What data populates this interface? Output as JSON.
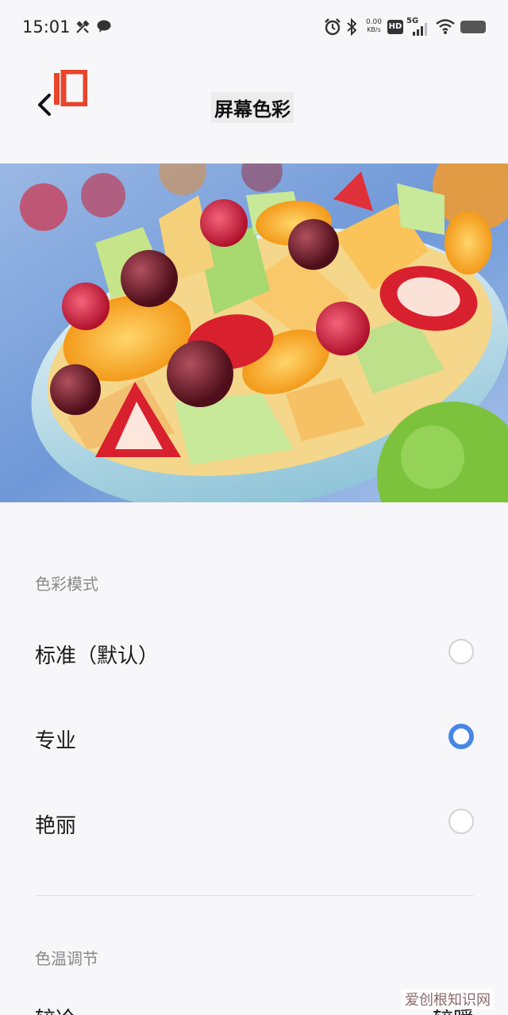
{
  "status_bar": {
    "time": "15:01",
    "net_speed_value": "0.00",
    "net_speed_unit": "KB/s",
    "hd_label": "HD",
    "network_type": "5G",
    "icons": [
      "tools-icon",
      "chat-bubble-icon",
      "alarm-icon",
      "bluetooth-icon",
      "signal-icon",
      "wifi-icon",
      "battery-icon"
    ]
  },
  "header": {
    "title": "屏幕色彩",
    "back_icon": "chevron-left-icon",
    "logo": "10",
    "logo_color": "#e8452c"
  },
  "color_mode": {
    "section_label": "色彩模式",
    "options": [
      {
        "label": "标准（默认）",
        "selected": false
      },
      {
        "label": "专业",
        "selected": true
      },
      {
        "label": "艳丽",
        "selected": false
      }
    ]
  },
  "color_temp": {
    "section_label": "色温调节",
    "left_label": "较冷",
    "right_label": "较暖"
  },
  "watermark": "爱创根知识网",
  "accent_color": "#4a86e8"
}
